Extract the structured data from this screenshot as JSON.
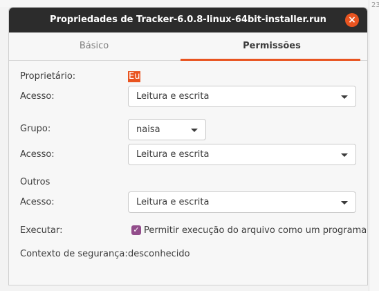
{
  "background": {
    "right_snippet_1": "23",
    "right_snippet_2": "l",
    "right_snippet_3": "o"
  },
  "dialog": {
    "title": "Propriedades de Tracker-6.0.8-linux-64bit-installer.run",
    "close_glyph": "×",
    "tabs": [
      {
        "label": "Básico",
        "active": false
      },
      {
        "label": "Permissões",
        "active": true
      }
    ]
  },
  "permissions": {
    "owner_label": "Proprietário:",
    "owner_value": "Eu",
    "owner_access_label": "Acesso:",
    "owner_access_value": "Leitura e escrita",
    "group_label": "Grupo:",
    "group_value": "naisa",
    "group_access_label": "Acesso:",
    "group_access_value": "Leitura e escrita",
    "others_label": "Outros",
    "others_access_label": "Acesso:",
    "others_access_value": "Leitura e escrita",
    "execute_label": "Executar:",
    "execute_checked": true,
    "execute_checkbox_label": "Permitir execução do arquivo como um programa",
    "security_context_label": "Contexto de segurança:",
    "security_context_value": "desconhecido"
  },
  "colors": {
    "accent": "#e95420",
    "checkbox": "#924d8b",
    "titlebar": "#2c2c2c"
  }
}
